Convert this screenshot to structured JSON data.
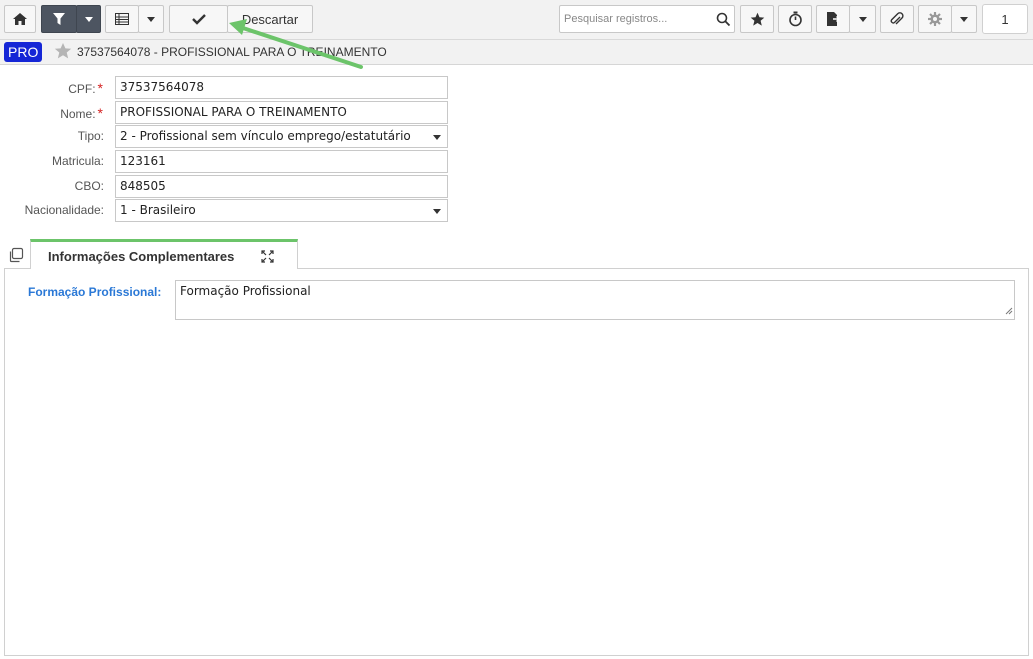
{
  "toolbar": {
    "home_icon": "home-icon",
    "filter_icon": "filter-icon",
    "grid_icon": "grid-icon",
    "confirm_icon": "checkmark-icon",
    "discard_label": "Descartar",
    "search_placeholder": "Pesquisar registros...",
    "favorite_icon": "star-icon",
    "timer_icon": "stopwatch-icon",
    "export_icon": "file-export-icon",
    "attach_icon": "paperclip-icon",
    "settings_icon": "gear-icon",
    "page_number": "1"
  },
  "record": {
    "badge": "PRO",
    "title": "37537564078 - PROFISSIONAL PARA O TREINAMENTO"
  },
  "form": {
    "cpf": {
      "label": "CPF:",
      "required": "*",
      "value": "37537564078"
    },
    "nome": {
      "label": "Nome:",
      "required": "*",
      "value": "PROFISSIONAL PARA O TREINAMENTO"
    },
    "tipo": {
      "label": "Tipo:",
      "value": "2 - Profissional sem vínculo emprego/estatutário"
    },
    "matricula": {
      "label": "Matricula:",
      "value": "123161"
    },
    "cbo": {
      "label": "CBO:",
      "value": "848505"
    },
    "nacionalidade": {
      "label": "Nacionalidade:",
      "value": "1 - Brasileiro"
    }
  },
  "tabs": [
    {
      "label": "Informações Complementares"
    }
  ],
  "complementares": {
    "formacao_label": "Formação Profissional:",
    "formacao_value": "Formação Profissional"
  },
  "colors": {
    "accent_green": "#6cc46a",
    "badge_blue": "#1526d6",
    "label_blue": "#2a78d6",
    "required_red": "#d42020"
  }
}
